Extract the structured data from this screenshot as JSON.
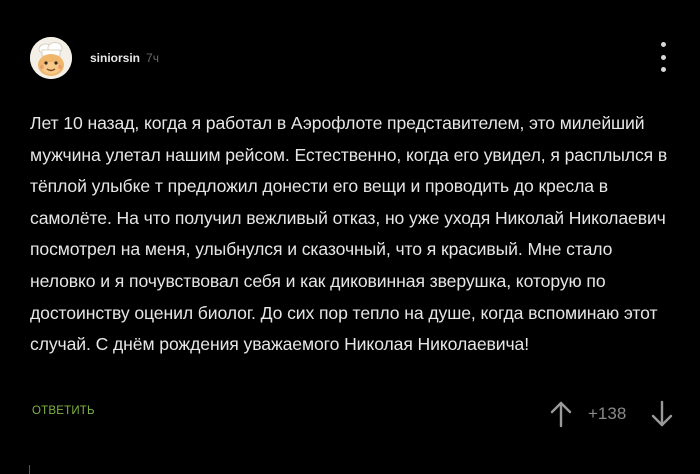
{
  "comment": {
    "author": {
      "username": "siniorsin",
      "time_ago": "7ч",
      "avatar_icon": "cartoon-avatar-icon"
    },
    "text": "Лет 10 назад, когда я работал в Аэрофлоте представителем, это милейший мужчина улетал нашим рейсом. Естественно, когда его увидел, я расплылся в тёплой улыбке т предложил донести его вещи и проводить до кресла в самолёте. На что получил вежливый отказ, но уже уходя Николай Николаевич посмотрел на меня, улыбнулся и сказочный, что я красивый. Мне стало неловко и я почувствовал себя и как диковинная зверушка, которую по достоинству оценил биолог. До сих пор тепло на душе, когда вспоминаю этот случай. С днём рождения уважаемого Николая Николаевича!",
    "reply_label": "ОТВЕТИТЬ",
    "rating": "+138",
    "menu_icon": "more-vertical-icon",
    "upvote_icon": "arrow-up-icon",
    "downvote_icon": "arrow-down-icon"
  },
  "colors": {
    "background": "#000000",
    "text": "#e6e6e6",
    "reply": "#7cb342",
    "muted": "#8a8a8a"
  }
}
